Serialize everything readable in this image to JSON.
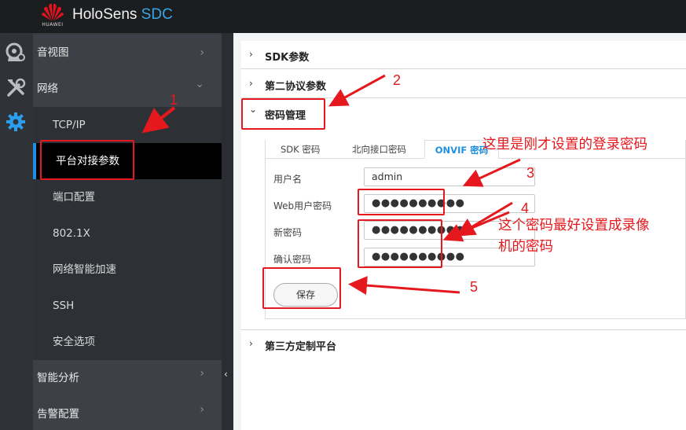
{
  "app": {
    "logo_text": "HUAWEI",
    "title_main": "HoloSens",
    "title_accent": "SDC"
  },
  "rail": {
    "icons": [
      "camera-settings-icon",
      "tools-icon",
      "gear-icon"
    ]
  },
  "sidebar": {
    "items": [
      {
        "label": "音视图",
        "chevron": "›"
      },
      {
        "label": "网络",
        "chevron": "⌄"
      },
      {
        "label": "TCP/IP"
      },
      {
        "label": "平台对接参数"
      },
      {
        "label": "端口配置"
      },
      {
        "label": "802.1X"
      },
      {
        "label": "网络智能加速"
      },
      {
        "label": "SSH"
      },
      {
        "label": "安全选项"
      },
      {
        "label": "智能分析",
        "chevron": "›"
      },
      {
        "label": "告警配置",
        "chevron": "›"
      }
    ],
    "collapse_arrow": "‹"
  },
  "sections": {
    "sdk": {
      "label": "SDK参数",
      "arrow": "›"
    },
    "second_protocol": {
      "label": "第二协议参数",
      "arrow": "›"
    },
    "password_mgmt": {
      "label": "密码管理",
      "arrow": "⌄"
    },
    "third_party": {
      "label": "第三方定制平台",
      "arrow": "›"
    }
  },
  "tabs": [
    "SDK 密码",
    "北向接口密码",
    "ONVIF 密码"
  ],
  "form": {
    "username_label": "用户名",
    "username_value": "admin",
    "web_password_label": "Web用户密码",
    "web_password_value": "●●●●●●●●●●",
    "new_password_label": "新密码",
    "new_password_value": "●●●●●●●●●●",
    "confirm_password_label": "确认密码",
    "confirm_password_value": "●●●●●●●●●●",
    "save_label": "保存"
  },
  "annotations": {
    "n1": "1",
    "n2": "2",
    "n3": "3",
    "n4": "4",
    "n5": "5",
    "note_login": "这里是刚才设置的登录密码",
    "note_nvr_line1": "这个密码最好设置成录像",
    "note_nvr_line2": "机的密码"
  },
  "colors": {
    "accent": "#1f8fe0",
    "annotation_red": "#e5191d",
    "topbar": "#1b1d1f",
    "sidebar": "#373b41"
  }
}
